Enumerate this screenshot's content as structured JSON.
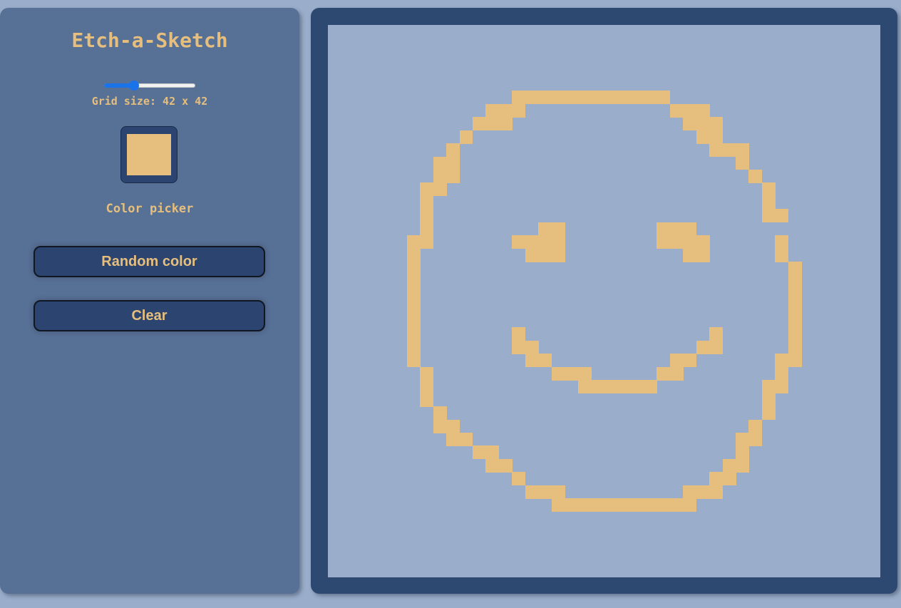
{
  "app": {
    "title": "Etch-a-Sketch"
  },
  "controls": {
    "grid_size_label": "Grid size: 42 x 42",
    "grid_size": 42,
    "slider_fraction": 0.33,
    "color_picker_label": "Color picker",
    "selected_color": "#e6bf7e",
    "random_color_label": "Random color",
    "clear_label": "Clear"
  },
  "colors": {
    "panel": "#577096",
    "board_frame": "#2d4871",
    "canvas_background": "#9aaecb",
    "button_bg": "#2b4570",
    "accent_text": "#e6bf7e",
    "slider_accent": "#1a73e8"
  },
  "drawing": {
    "grid_size": 42,
    "color": "#e6bf7e",
    "runs": [
      [
        5,
        14,
        25
      ],
      [
        6,
        12,
        14
      ],
      [
        6,
        26,
        28
      ],
      [
        7,
        11,
        13
      ],
      [
        7,
        27,
        29
      ],
      [
        8,
        10,
        10
      ],
      [
        8,
        28,
        29
      ],
      [
        9,
        9,
        9
      ],
      [
        9,
        29,
        31
      ],
      [
        10,
        8,
        9
      ],
      [
        10,
        31,
        31
      ],
      [
        11,
        8,
        9
      ],
      [
        11,
        32,
        32
      ],
      [
        12,
        7,
        8
      ],
      [
        12,
        33,
        33
      ],
      [
        13,
        7,
        7
      ],
      [
        13,
        33,
        33
      ],
      [
        14,
        7,
        7
      ],
      [
        14,
        33,
        34
      ],
      [
        15,
        7,
        7
      ],
      [
        15,
        16,
        17
      ],
      [
        15,
        25,
        27
      ],
      [
        16,
        6,
        7
      ],
      [
        16,
        14,
        17
      ],
      [
        16,
        25,
        28
      ],
      [
        16,
        34,
        34
      ],
      [
        17,
        6,
        6
      ],
      [
        17,
        15,
        17
      ],
      [
        17,
        27,
        28
      ],
      [
        17,
        34,
        34
      ],
      [
        18,
        6,
        6
      ],
      [
        18,
        35,
        35
      ],
      [
        19,
        6,
        6
      ],
      [
        19,
        35,
        35
      ],
      [
        20,
        6,
        6
      ],
      [
        20,
        35,
        35
      ],
      [
        21,
        6,
        6
      ],
      [
        21,
        35,
        35
      ],
      [
        22,
        6,
        6
      ],
      [
        22,
        35,
        35
      ],
      [
        23,
        6,
        6
      ],
      [
        23,
        14,
        14
      ],
      [
        23,
        29,
        29
      ],
      [
        23,
        35,
        35
      ],
      [
        24,
        6,
        6
      ],
      [
        24,
        14,
        15
      ],
      [
        24,
        28,
        29
      ],
      [
        24,
        35,
        35
      ],
      [
        25,
        6,
        6
      ],
      [
        25,
        15,
        16
      ],
      [
        25,
        26,
        27
      ],
      [
        25,
        34,
        35
      ],
      [
        26,
        7,
        7
      ],
      [
        26,
        17,
        19
      ],
      [
        26,
        25,
        26
      ],
      [
        26,
        34,
        34
      ],
      [
        27,
        7,
        7
      ],
      [
        27,
        19,
        24
      ],
      [
        27,
        33,
        34
      ],
      [
        28,
        7,
        7
      ],
      [
        28,
        33,
        33
      ],
      [
        29,
        8,
        8
      ],
      [
        29,
        33,
        33
      ],
      [
        30,
        8,
        9
      ],
      [
        30,
        32,
        32
      ],
      [
        31,
        9,
        10
      ],
      [
        31,
        31,
        32
      ],
      [
        32,
        11,
        12
      ],
      [
        32,
        31,
        31
      ],
      [
        33,
        12,
        13
      ],
      [
        33,
        30,
        31
      ],
      [
        34,
        14,
        14
      ],
      [
        34,
        29,
        30
      ],
      [
        35,
        15,
        17
      ],
      [
        35,
        27,
        29
      ],
      [
        36,
        17,
        27
      ]
    ]
  }
}
